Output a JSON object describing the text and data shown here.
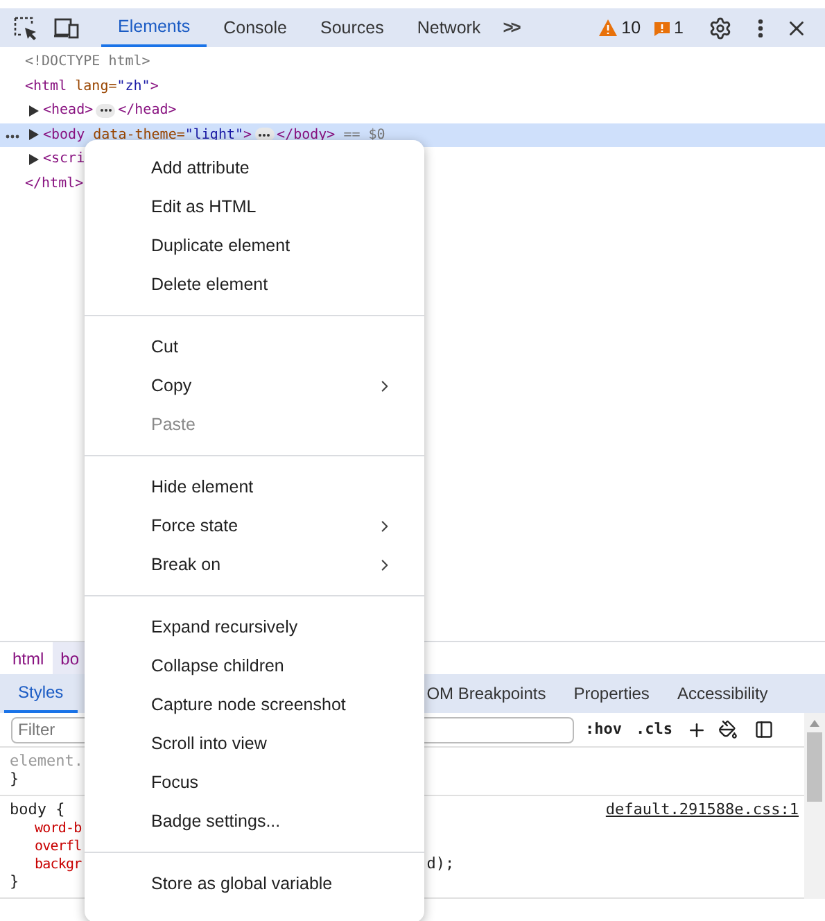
{
  "toolbar": {
    "tabs": [
      {
        "label": "Elements",
        "selected": true
      },
      {
        "label": "Console",
        "selected": false
      },
      {
        "label": "Sources",
        "selected": false
      },
      {
        "label": "Network",
        "selected": false
      }
    ],
    "more": ">>",
    "warnings": "10",
    "issues": "1"
  },
  "dom": [
    {
      "kind": "comment",
      "text": "<!DOCTYPE html>",
      "selected": false
    },
    {
      "kind": "open",
      "tag": "<html",
      "attr": " lang=",
      "value": "\"zh\"",
      "end": ">",
      "selected": false
    },
    {
      "kind": "collapsed",
      "tag": "<head>",
      "close": "</head>",
      "selected": false
    },
    {
      "kind": "collapsed",
      "tag": "<body",
      "attr": " data-theme=",
      "value": "\"light\"",
      "end": ">",
      "close": "</body>",
      "suffix": " == $0",
      "selected": true
    },
    {
      "kind": "cut",
      "tag": "<scri",
      "selected": false
    },
    {
      "kind": "closing",
      "tag": "</html>",
      "selected": false
    }
  ],
  "breadcrumbs": [
    {
      "label": "html",
      "selected": false
    },
    {
      "label": "bo",
      "selected": true
    }
  ],
  "styles_tabs": [
    {
      "label": "Styles",
      "selected": true
    },
    {
      "label": "OM Breakpoints",
      "selected": false
    },
    {
      "label": "Properties",
      "selected": false
    },
    {
      "label": "Accessibility",
      "selected": false
    }
  ],
  "filter": {
    "placeholder": "Filter",
    "hov": ":hov",
    "cls": ".cls"
  },
  "rules": [
    {
      "lines": [
        {
          "kind": "selector",
          "text": "element."
        },
        {
          "kind": "brace",
          "text": "}"
        }
      ]
    },
    {
      "source": "default.291588e.css:1",
      "lines": [
        {
          "kind": "selector",
          "text": "body {"
        },
        {
          "kind": "prop",
          "text": "word-b"
        },
        {
          "kind": "prop",
          "text": "overfl"
        },
        {
          "kind": "prop",
          "text": "backgr",
          "tail": "d);"
        },
        {
          "kind": "brace",
          "text": "}"
        }
      ]
    }
  ],
  "menu": [
    [
      {
        "label": "Add attribute",
        "disabled": false,
        "submenu": false
      },
      {
        "label": "Edit as HTML",
        "disabled": false,
        "submenu": false
      },
      {
        "label": "Duplicate element",
        "disabled": false,
        "submenu": false
      },
      {
        "label": "Delete element",
        "disabled": false,
        "submenu": false
      }
    ],
    [
      {
        "label": "Cut",
        "disabled": false,
        "submenu": false
      },
      {
        "label": "Copy",
        "disabled": false,
        "submenu": true
      },
      {
        "label": "Paste",
        "disabled": true,
        "submenu": false
      }
    ],
    [
      {
        "label": "Hide element",
        "disabled": false,
        "submenu": false
      },
      {
        "label": "Force state",
        "disabled": false,
        "submenu": true
      },
      {
        "label": "Break on",
        "disabled": false,
        "submenu": true
      }
    ],
    [
      {
        "label": "Expand recursively",
        "disabled": false,
        "submenu": false
      },
      {
        "label": "Collapse children",
        "disabled": false,
        "submenu": false
      },
      {
        "label": "Capture node screenshot",
        "disabled": false,
        "submenu": false
      },
      {
        "label": "Scroll into view",
        "disabled": false,
        "submenu": false
      },
      {
        "label": "Focus",
        "disabled": false,
        "submenu": false
      },
      {
        "label": "Badge settings...",
        "disabled": false,
        "submenu": false
      }
    ],
    [
      {
        "label": "Store as global variable",
        "disabled": false,
        "submenu": false
      }
    ]
  ]
}
